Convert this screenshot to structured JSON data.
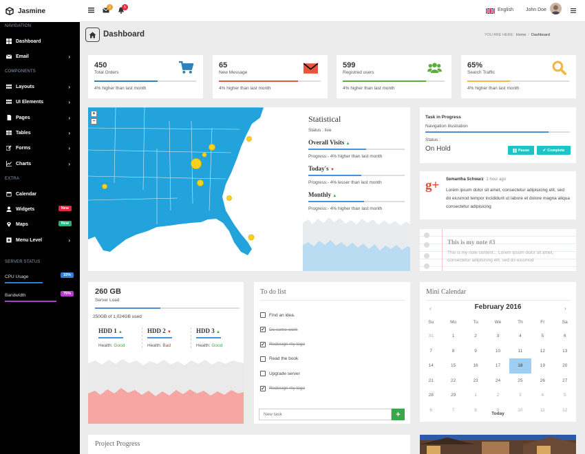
{
  "brand": {
    "name": "Jasmine"
  },
  "sidebar": {
    "sections": {
      "navigation": "NAVIGATION",
      "components": "COMPONENTS",
      "extra": "EXTRA",
      "server_status": "SERVER STATUS"
    },
    "items": [
      {
        "label": "Dashboard",
        "icon": "dashboard-icon"
      },
      {
        "label": "Email",
        "icon": "envelope-icon"
      },
      {
        "label": "Layouts",
        "icon": "grid-icon"
      },
      {
        "label": "UI Elements",
        "icon": "grid-icon"
      },
      {
        "label": "Pages",
        "icon": "file-icon"
      },
      {
        "label": "Tables",
        "icon": "table-icon"
      },
      {
        "label": "Forms",
        "icon": "edit-icon"
      },
      {
        "label": "Charts",
        "icon": "chart-icon"
      },
      {
        "label": "Calendar",
        "icon": "calendar-icon"
      },
      {
        "label": "Widgets",
        "icon": "user-icon",
        "badge": "New",
        "badge_color": "#e8253b"
      },
      {
        "label": "Maps",
        "icon": "map-marker-icon",
        "badge": "New",
        "badge_color": "#2ab27b"
      },
      {
        "label": "Menu Level",
        "icon": "plus-square-icon"
      }
    ],
    "server": [
      {
        "label": "CPU Usage",
        "badge": "15%",
        "color": "#2f7fd8",
        "fraction": 0.55
      },
      {
        "label": "Bandwidth",
        "badge": "75%",
        "color": "#b23dc6",
        "fraction": 0.75
      }
    ]
  },
  "header": {
    "mail_count": "2",
    "alert_count": "5",
    "language": "English",
    "user": "John Doe"
  },
  "page": {
    "title": "Dashboard",
    "breadcrumb_prefix": "YOU ARE HERE:",
    "breadcrumb_home": "Home",
    "breadcrumb_current": "Dashboard"
  },
  "stats": [
    {
      "value": "450",
      "label": "Total Orders",
      "foot": "4% higher than last month",
      "color": "#2e82b8",
      "fill": 0.62,
      "icon": "cart-icon"
    },
    {
      "value": "65",
      "label": "New Message",
      "foot": "4% higher than last month",
      "color": "#e8543c",
      "fill": 0.78,
      "icon": "envelope-icon"
    },
    {
      "value": "599",
      "label": "Registred users",
      "foot": "4% higher than last month",
      "color": "#5cad3a",
      "fill": 0.82,
      "icon": "users-icon"
    },
    {
      "value": "65%",
      "label": "Search Traffic",
      "foot": "4% higher than last month",
      "color": "#f0b840",
      "fill": 0.42,
      "icon": "search-icon"
    }
  ],
  "map": {
    "zoom_in": "+",
    "zoom_out": "−"
  },
  "statistical": {
    "title": "Statistical",
    "status": "Status : live",
    "metrics": [
      {
        "name": "Overall Visits",
        "trend": "up",
        "progress": "Progress:- 4% higher than last month",
        "fill": 0.6
      },
      {
        "name": "Today's",
        "trend": "down",
        "progress": "Progress:- 4% lesser than last month",
        "fill": 0.55
      },
      {
        "name": "Monthly",
        "trend": "up",
        "progress": "Progress:- 4% higher than last month",
        "fill": 0.58
      }
    ]
  },
  "task": {
    "title": "Task in Progress",
    "subtitle": "Navigation illustration",
    "fill": 0.85,
    "status_label": "Status :",
    "status": "On Hold",
    "pause": "Pause",
    "complete": "Complete"
  },
  "gplus": {
    "name": "Semantha Schwarz",
    "time": "1 hour ago",
    "text": "Lorem ipsum dolor sit amet, consectetur adipisicing elit, sed do eiusmod tempor incididunt ut labore et dolore magna aliqua consectetur adipisicing"
  },
  "note": {
    "title": "This is my note #3",
    "text": "This is my note content... Lorem ipsum dolor sit amet, consectetur adipisicing elit, sed do eiusmod"
  },
  "server": {
    "value": "260 GB",
    "label": "Server Load",
    "fill": 0.45,
    "usage": "250GB of 1,024GB used",
    "health_label": "Health:",
    "hdds": [
      {
        "name": "HDD 1",
        "trend": "up",
        "health": "Good",
        "color": "#3aa53a"
      },
      {
        "name": "HDD 2",
        "trend": "down",
        "health": "Bad",
        "color": "#e02b2b"
      },
      {
        "name": "HDD 3",
        "trend": "up",
        "health": "Good",
        "color": "#3aa53a"
      }
    ]
  },
  "todo": {
    "title": "To do list",
    "placeholder": "New task",
    "add": "+",
    "items": [
      {
        "label": "Find an idea.",
        "done": false
      },
      {
        "label": "Do some work",
        "done": true
      },
      {
        "label": "Redesign my logo",
        "done": true
      },
      {
        "label": "Read the book",
        "done": false
      },
      {
        "label": "Upgrade server",
        "done": false
      },
      {
        "label": "Redesign my logo",
        "done": true
      }
    ]
  },
  "calendar": {
    "title": "Mini Calendar",
    "month": "February 2016",
    "prev": "‹",
    "next": "›",
    "today": "Today",
    "days": [
      "Su",
      "Mo",
      "Tu",
      "We",
      "Th",
      "Fr",
      "Sa"
    ],
    "weeks": [
      [
        "31",
        "1",
        "2",
        "3",
        "4",
        "5",
        "6"
      ],
      [
        "7",
        "8",
        "9",
        "10",
        "11",
        "12",
        "13"
      ],
      [
        "14",
        "15",
        "16",
        "17",
        "18",
        "19",
        "20"
      ],
      [
        "21",
        "22",
        "23",
        "24",
        "25",
        "26",
        "27"
      ],
      [
        "28",
        "29",
        "1",
        "2",
        "3",
        "4",
        "5"
      ],
      [
        "6",
        "7",
        "8",
        "9",
        "10",
        "11",
        "12"
      ]
    ],
    "selected": "18"
  },
  "project": {
    "title": "Project Progress"
  }
}
